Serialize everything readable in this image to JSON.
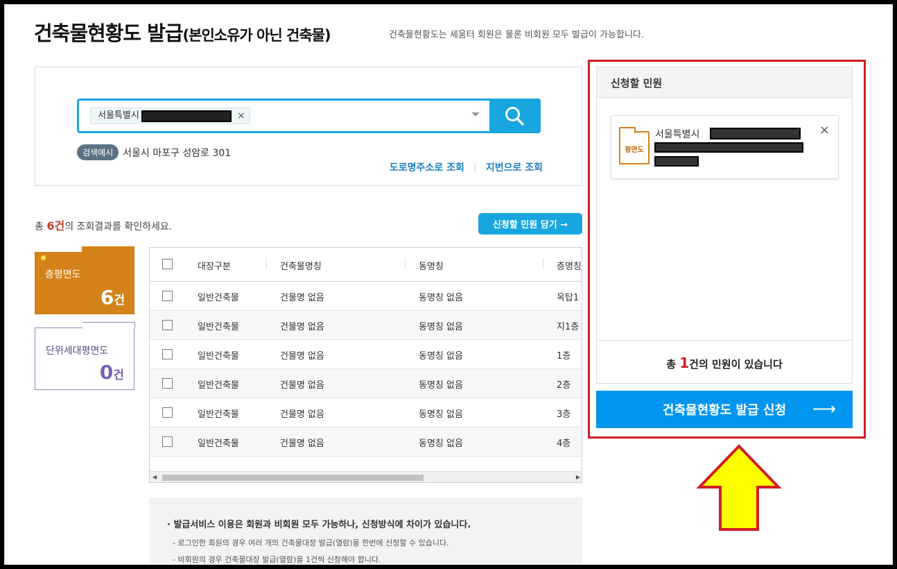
{
  "header": {
    "title": "건축물현황도 발급",
    "title_sub": "(본인소유가 아닌 건축물)",
    "description": "건축물현황도는 세움터 회원은 물론 비회원 모두 발급이 가능합니다."
  },
  "search": {
    "chip_text": "서울특별시",
    "chip_close": "×",
    "example_badge": "검색예시",
    "example_text": "서울시 마포구 성암로 301",
    "link_road": "도로명주소로 조회",
    "link_lot": "지번으로 조회"
  },
  "results": {
    "prefix": "총 ",
    "count": "6건",
    "suffix": "의 조회결과를 확인하세요.",
    "add_button": "신청할 민원 담기 →"
  },
  "categories": [
    {
      "label": "층평면도",
      "count": "6",
      "unit": "건"
    },
    {
      "label": "단위세대평면도",
      "count": "0",
      "unit": "건"
    }
  ],
  "table": {
    "headers": [
      "대장구분",
      "건축물명칭",
      "동명칭",
      "층명칭"
    ],
    "rows": [
      {
        "type": "일반건축물",
        "name": "건물명 없음",
        "dong": "동명칭 없음",
        "floor": "옥탑1"
      },
      {
        "type": "일반건축물",
        "name": "건물명 없음",
        "dong": "동명칭 없음",
        "floor": "지1층"
      },
      {
        "type": "일반건축물",
        "name": "건물명 없음",
        "dong": "동명칭 없음",
        "floor": "1층"
      },
      {
        "type": "일반건축물",
        "name": "건물명 없음",
        "dong": "동명칭 없음",
        "floor": "2층"
      },
      {
        "type": "일반건축물",
        "name": "건물명 없음",
        "dong": "동명칭 없음",
        "floor": "3층"
      },
      {
        "type": "일반건축물",
        "name": "건물명 없음",
        "dong": "동명칭 없음",
        "floor": "4층"
      }
    ]
  },
  "info": {
    "line1": "· 발급서비스 이용은 회원과 비회원 모두 가능하나, 신청방식에 차이가 있습니다.",
    "line2": "- 로그인한 회원의 경우 여러 개의 건축물대장 발급(열람)을 한번에 신청할 수 있습니다.",
    "line3": "- 비회원의 경우 건축물대장 발급(열람)을 1건씩 신청해야 합니다."
  },
  "request_panel": {
    "title": "신청할 민원",
    "item_icon_label": "평면도",
    "item_address": "서울특별시",
    "item_close": "×",
    "footer_prefix": "총 ",
    "footer_count": "1",
    "footer_suffix": "건의 민원이 있습니다",
    "apply_button": "건축물현황도 발급 신청",
    "apply_arrow": "⟶"
  },
  "colors": {
    "accent_blue": "#17a6e0",
    "apply_blue": "#0096f0",
    "floor_orange": "#d4821a",
    "unit_purple": "#7b62b0",
    "highlight_red": "#d11c24",
    "arrow_yellow": "#ffff00"
  }
}
